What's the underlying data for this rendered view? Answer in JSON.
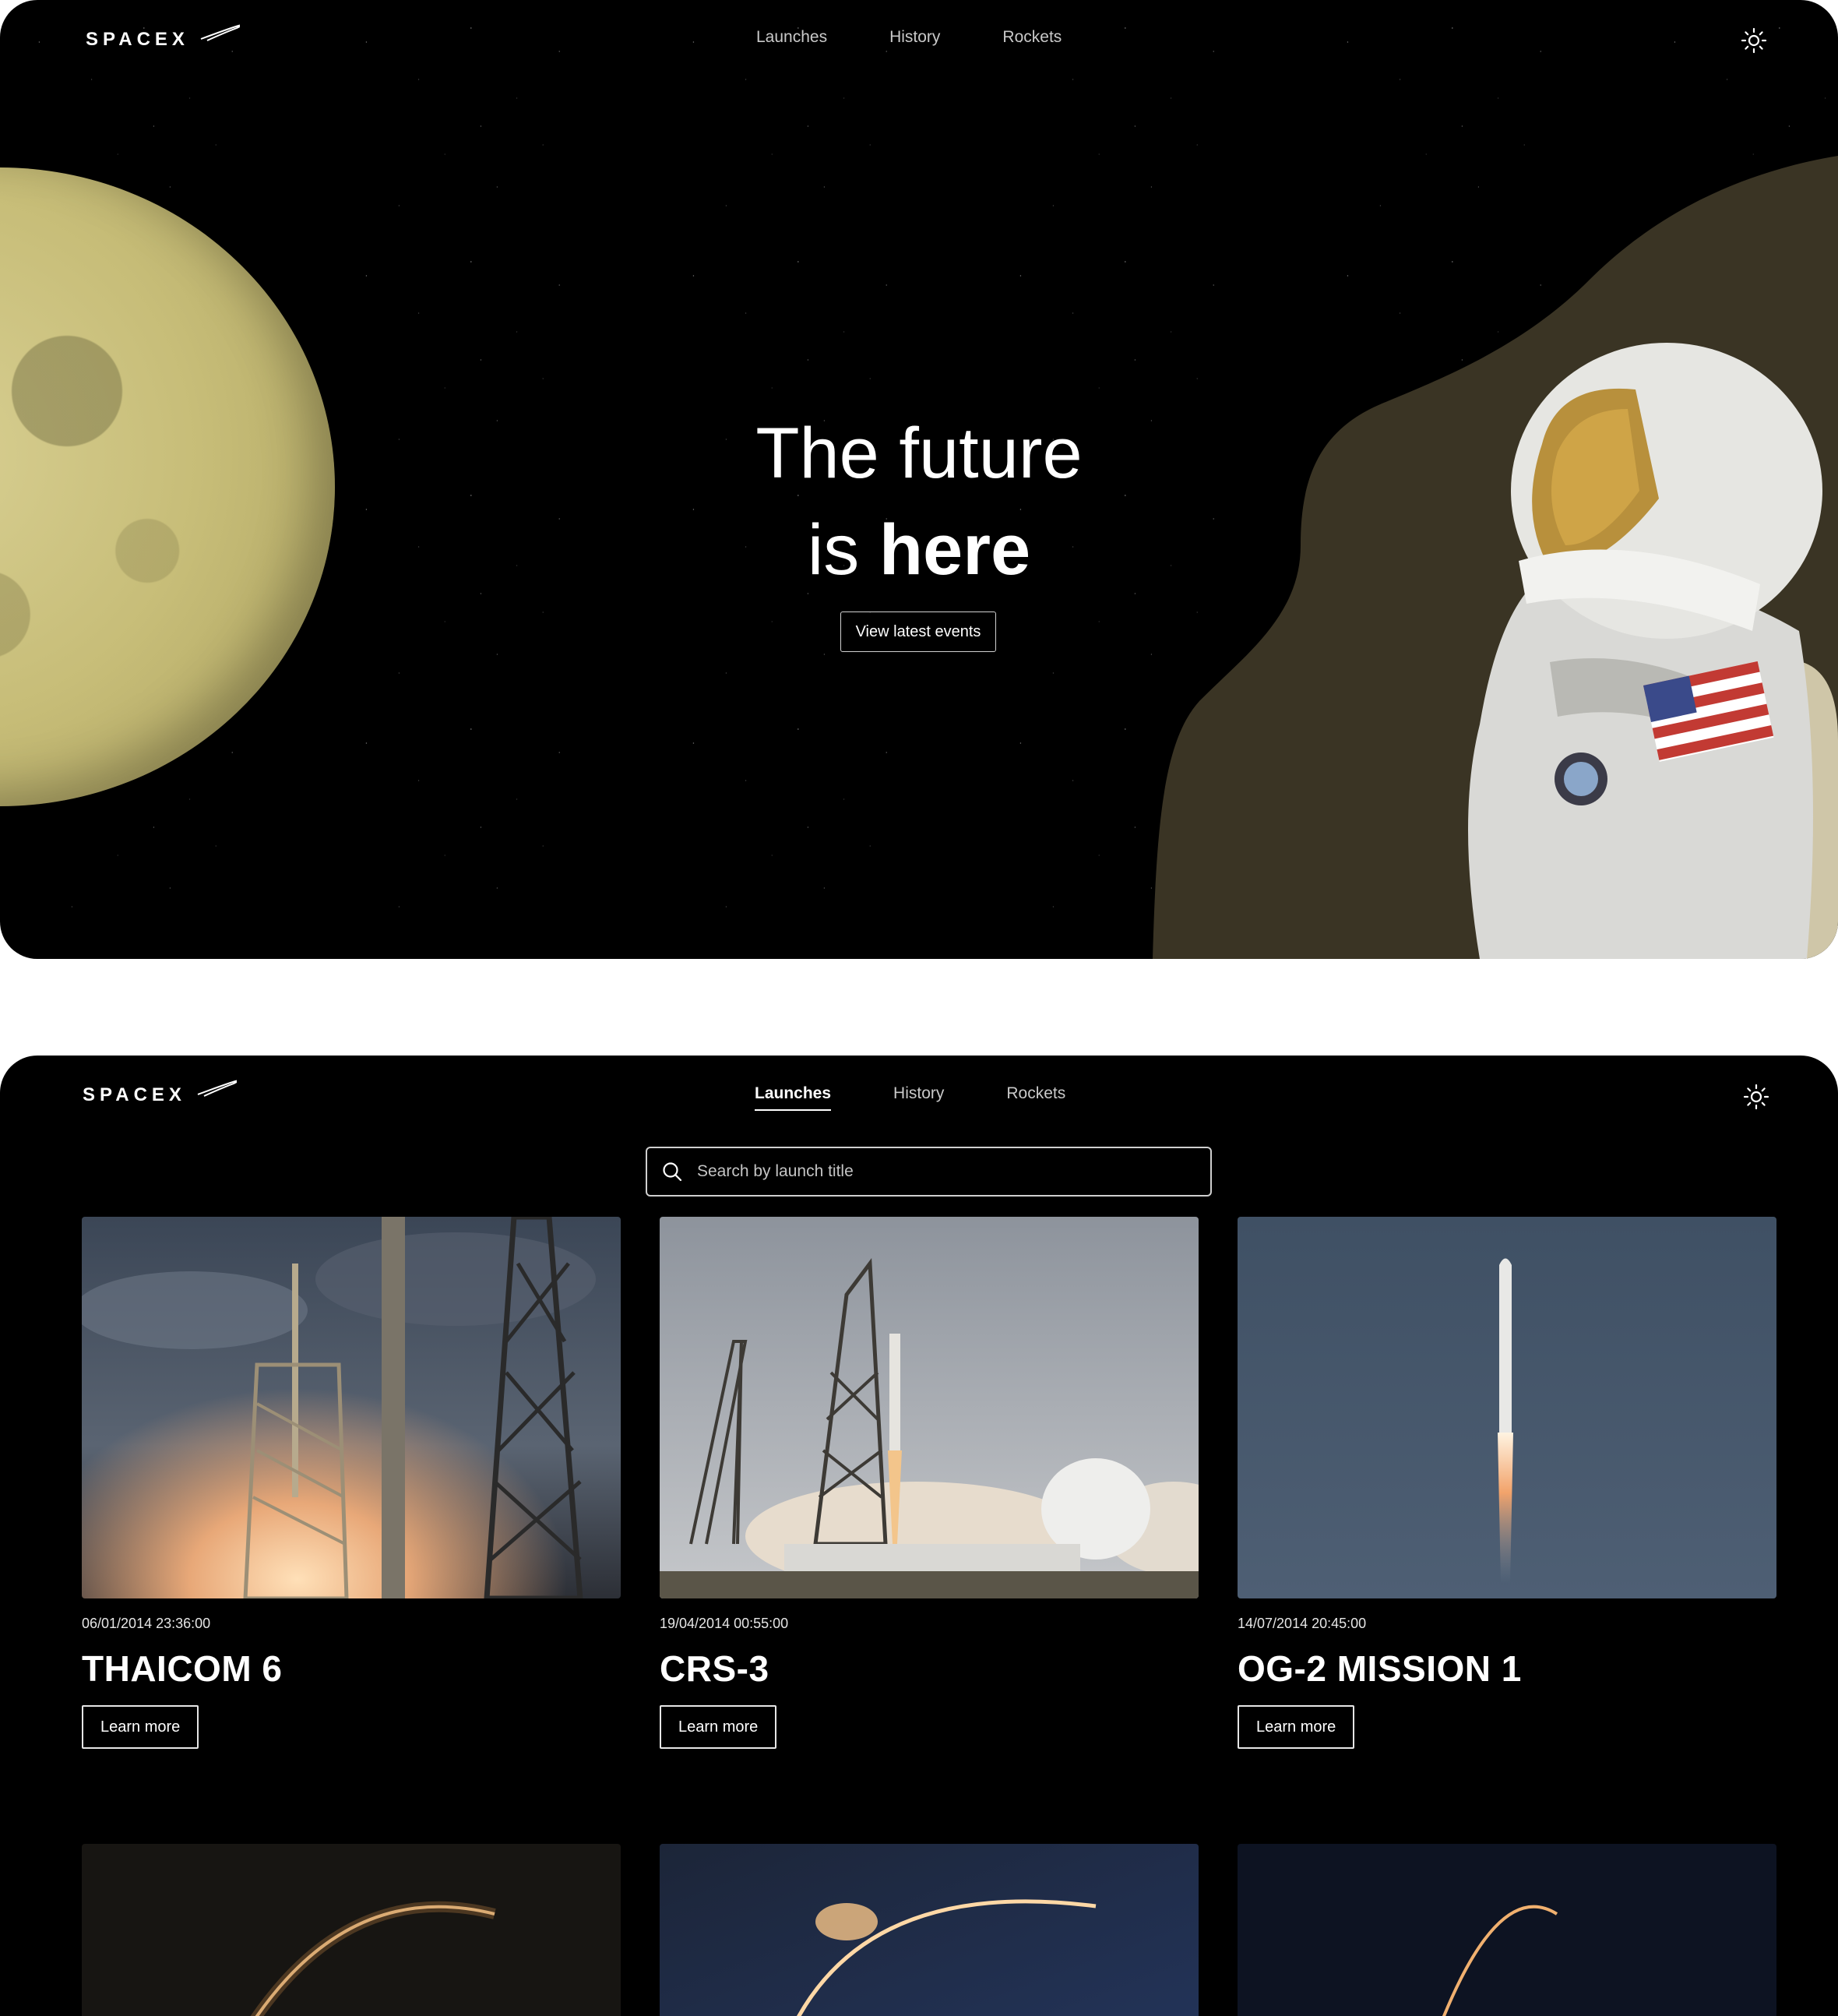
{
  "brand": {
    "logo_text": "SPACEX"
  },
  "nav": {
    "items": [
      {
        "label": "Launches"
      },
      {
        "label": "History"
      },
      {
        "label": "Rockets"
      }
    ]
  },
  "hero": {
    "title_line_1": "The future",
    "title_line_2_prefix": "is ",
    "title_line_2_bold": "here",
    "cta_label": "View latest events"
  },
  "search": {
    "placeholder": "Search by launch title"
  },
  "launches": [
    {
      "date": "06/01/2014 23:36:00",
      "title": "THAICOM 6",
      "button_label": "Learn more"
    },
    {
      "date": "19/04/2014 00:55:00",
      "title": "CRS-3",
      "button_label": "Learn more"
    },
    {
      "date": "14/07/2014 20:45:00",
      "title": "OG-2 MISSION 1",
      "button_label": "Learn more"
    }
  ],
  "theme_toggle_icon": "sun-icon",
  "colors": {
    "background": "#000000",
    "moon": "#d2c98b",
    "blob": "#3a3424",
    "text": "#ffffff"
  }
}
